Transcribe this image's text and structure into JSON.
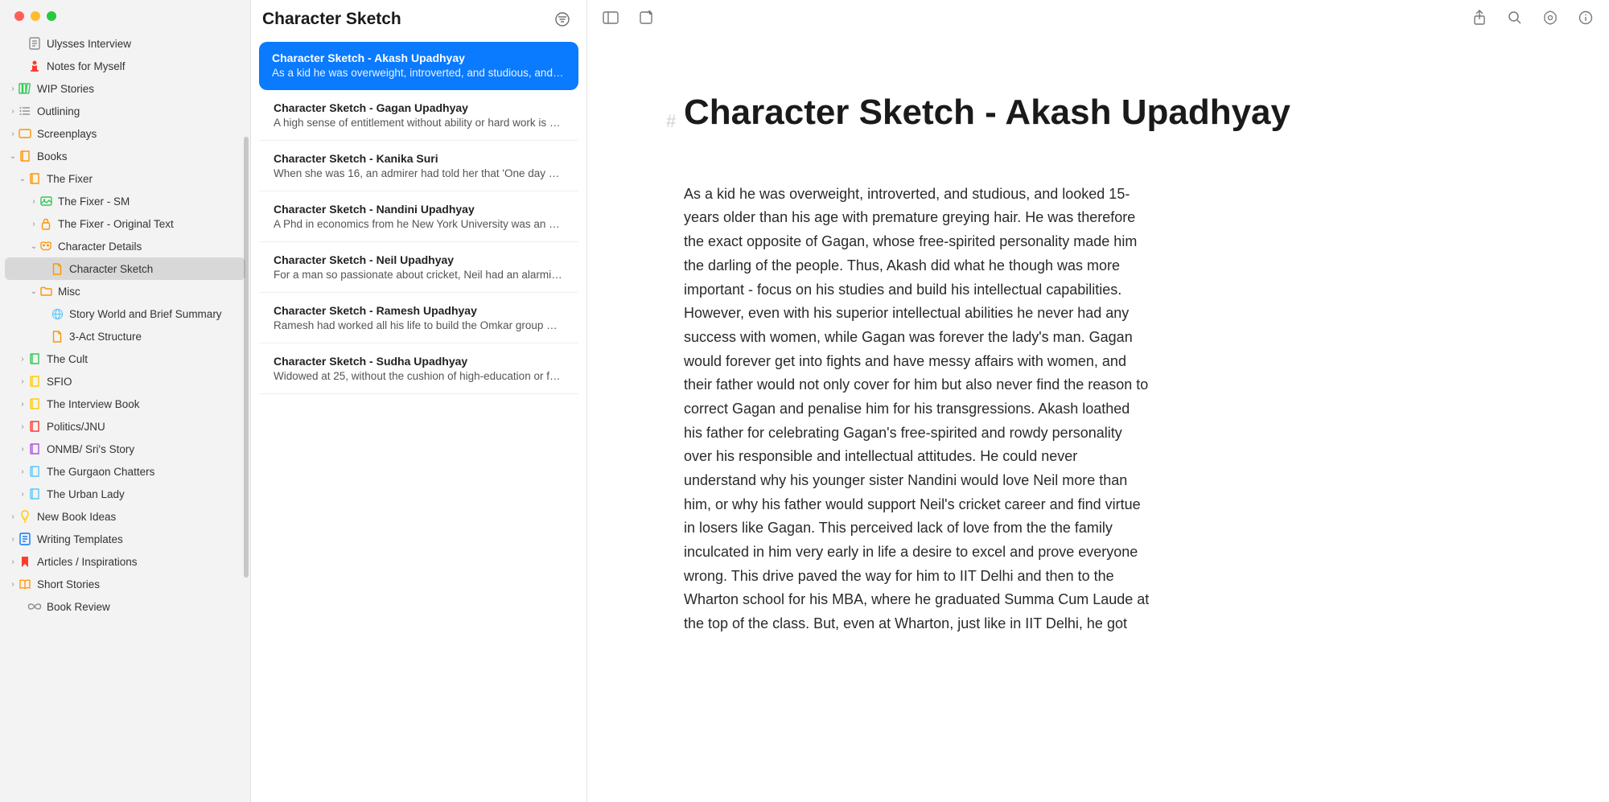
{
  "sidebar": {
    "items": [
      {
        "label": "Ulysses Interview",
        "icon": "doc",
        "color": "#8e8e93",
        "depth": 1,
        "chev": ""
      },
      {
        "label": "Notes for Myself",
        "icon": "pawn",
        "color": "#ff3b30",
        "depth": 1,
        "chev": ""
      },
      {
        "label": "WIP Stories",
        "icon": "books",
        "color": "#34c759",
        "depth": 0,
        "chev": "›"
      },
      {
        "label": "Outlining",
        "icon": "list",
        "color": "#8e8e93",
        "depth": 0,
        "chev": "›"
      },
      {
        "label": "Screenplays",
        "icon": "screen",
        "color": "#ff9500",
        "depth": 0,
        "chev": "›"
      },
      {
        "label": "Books",
        "icon": "book",
        "color": "#ff9500",
        "depth": 0,
        "chev": "⌄"
      },
      {
        "label": "The Fixer",
        "icon": "book",
        "color": "#ff9500",
        "depth": 1,
        "chev": "⌄"
      },
      {
        "label": "The Fixer - SM",
        "icon": "image",
        "color": "#34c759",
        "depth": 2,
        "chev": "›"
      },
      {
        "label": "The Fixer - Original Text",
        "icon": "lock",
        "color": "#ff9500",
        "depth": 2,
        "chev": "›"
      },
      {
        "label": "Character Details",
        "icon": "mask",
        "color": "#ff9500",
        "depth": 2,
        "chev": "⌄"
      },
      {
        "label": "Character Sketch",
        "icon": "page",
        "color": "#ff9500",
        "depth": 3,
        "chev": "",
        "selected": true
      },
      {
        "label": "Misc",
        "icon": "folder",
        "color": "#ff9500",
        "depth": 2,
        "chev": "⌄"
      },
      {
        "label": "Story World and Brief Summary",
        "icon": "globe",
        "color": "#5ac8fa",
        "depth": 3,
        "chev": ""
      },
      {
        "label": "3-Act Structure",
        "icon": "page",
        "color": "#ff9500",
        "depth": 3,
        "chev": ""
      },
      {
        "label": "The Cult",
        "icon": "book",
        "color": "#34c759",
        "depth": 1,
        "chev": "›"
      },
      {
        "label": "SFIO",
        "icon": "book",
        "color": "#ffcc00",
        "depth": 1,
        "chev": "›"
      },
      {
        "label": "The Interview Book",
        "icon": "book",
        "color": "#ffcc00",
        "depth": 1,
        "chev": "›"
      },
      {
        "label": "Politics/JNU",
        "icon": "book",
        "color": "#ff3b30",
        "depth": 1,
        "chev": "›"
      },
      {
        "label": "ONMB/ Sri's Story",
        "icon": "book",
        "color": "#af52de",
        "depth": 1,
        "chev": "›"
      },
      {
        "label": "The Gurgaon Chatters",
        "icon": "book",
        "color": "#5ac8fa",
        "depth": 1,
        "chev": "›"
      },
      {
        "label": "The Urban Lady",
        "icon": "book",
        "color": "#5ac8fa",
        "depth": 1,
        "chev": "›"
      },
      {
        "label": "New Book Ideas",
        "icon": "bulb",
        "color": "#ffcc00",
        "depth": 0,
        "chev": "›"
      },
      {
        "label": "Writing Templates",
        "icon": "doc",
        "color": "#007aff",
        "depth": 0,
        "chev": "›"
      },
      {
        "label": "Articles / Inspirations",
        "icon": "bookmark",
        "color": "#ff3b30",
        "depth": 0,
        "chev": "›"
      },
      {
        "label": "Short Stories",
        "icon": "openbook",
        "color": "#ff9500",
        "depth": 0,
        "chev": "›"
      },
      {
        "label": "Book Review",
        "icon": "infinity",
        "color": "#8e8e93",
        "depth": 1,
        "chev": ""
      }
    ]
  },
  "middle": {
    "title": "Character Sketch",
    "notes": [
      {
        "title": "Character Sketch - Akash Upadhyay",
        "preview": "As a kid he was overweight, introverted, and studious, and l…",
        "selected": true
      },
      {
        "title": "Character Sketch - Gagan Upadhyay",
        "preview": "A high sense of entitlement without ability or hard work is a…"
      },
      {
        "title": "Character Sketch - Kanika Suri",
        "preview": "When she was 16, an admirer had told her that 'One day you…"
      },
      {
        "title": "Character Sketch - Nandini Upadhyay",
        "preview": "A Phd in economics from he New York University was an ab…"
      },
      {
        "title": "Character Sketch - Neil Upadhyay",
        "preview": "For a man so passionate about cricket, Neil had an alarming…"
      },
      {
        "title": "Character Sketch - Ramesh Upadhyay",
        "preview": "Ramesh had worked all his life to build the Omkar group wit…"
      },
      {
        "title": "Character Sketch - Sudha Upadhyay",
        "preview": "Widowed at 25, without the cushion of high-education or fa…"
      }
    ]
  },
  "editor": {
    "title": "Character Sketch - Akash Upadhyay",
    "body": "As a kid he was overweight, introverted, and studious, and looked 15-years older than his age with premature greying hair.  He was therefore the exact opposite of Gagan, whose free-spirited personality made him the darling of the people. Thus, Akash did what he though was more important - focus on his studies and build his intellectual capabilities. However, even with his superior intellectual abilities he never had any success with women, while Gagan was forever the lady's man. Gagan would forever get into fights and have messy affairs with women, and their father would not only cover for him but also never find the reason to correct Gagan and penalise him for his transgressions. Akash loathed his father for celebrating Gagan's free-spirited and rowdy personality over his responsible and intellectual attitudes. He could never understand why his younger sister Nandini would love Neil more than him, or why his father would support Neil's cricket career and find virtue in losers like Gagan. This perceived lack of love from the the family inculcated in him very early in life a desire to excel and prove everyone wrong. This drive paved the way for him to IIT Delhi and then to the Wharton school for his MBA, where he graduated Summa Cum Laude at the top of the class. But, even at Wharton, just like in IIT Delhi, he got"
  }
}
